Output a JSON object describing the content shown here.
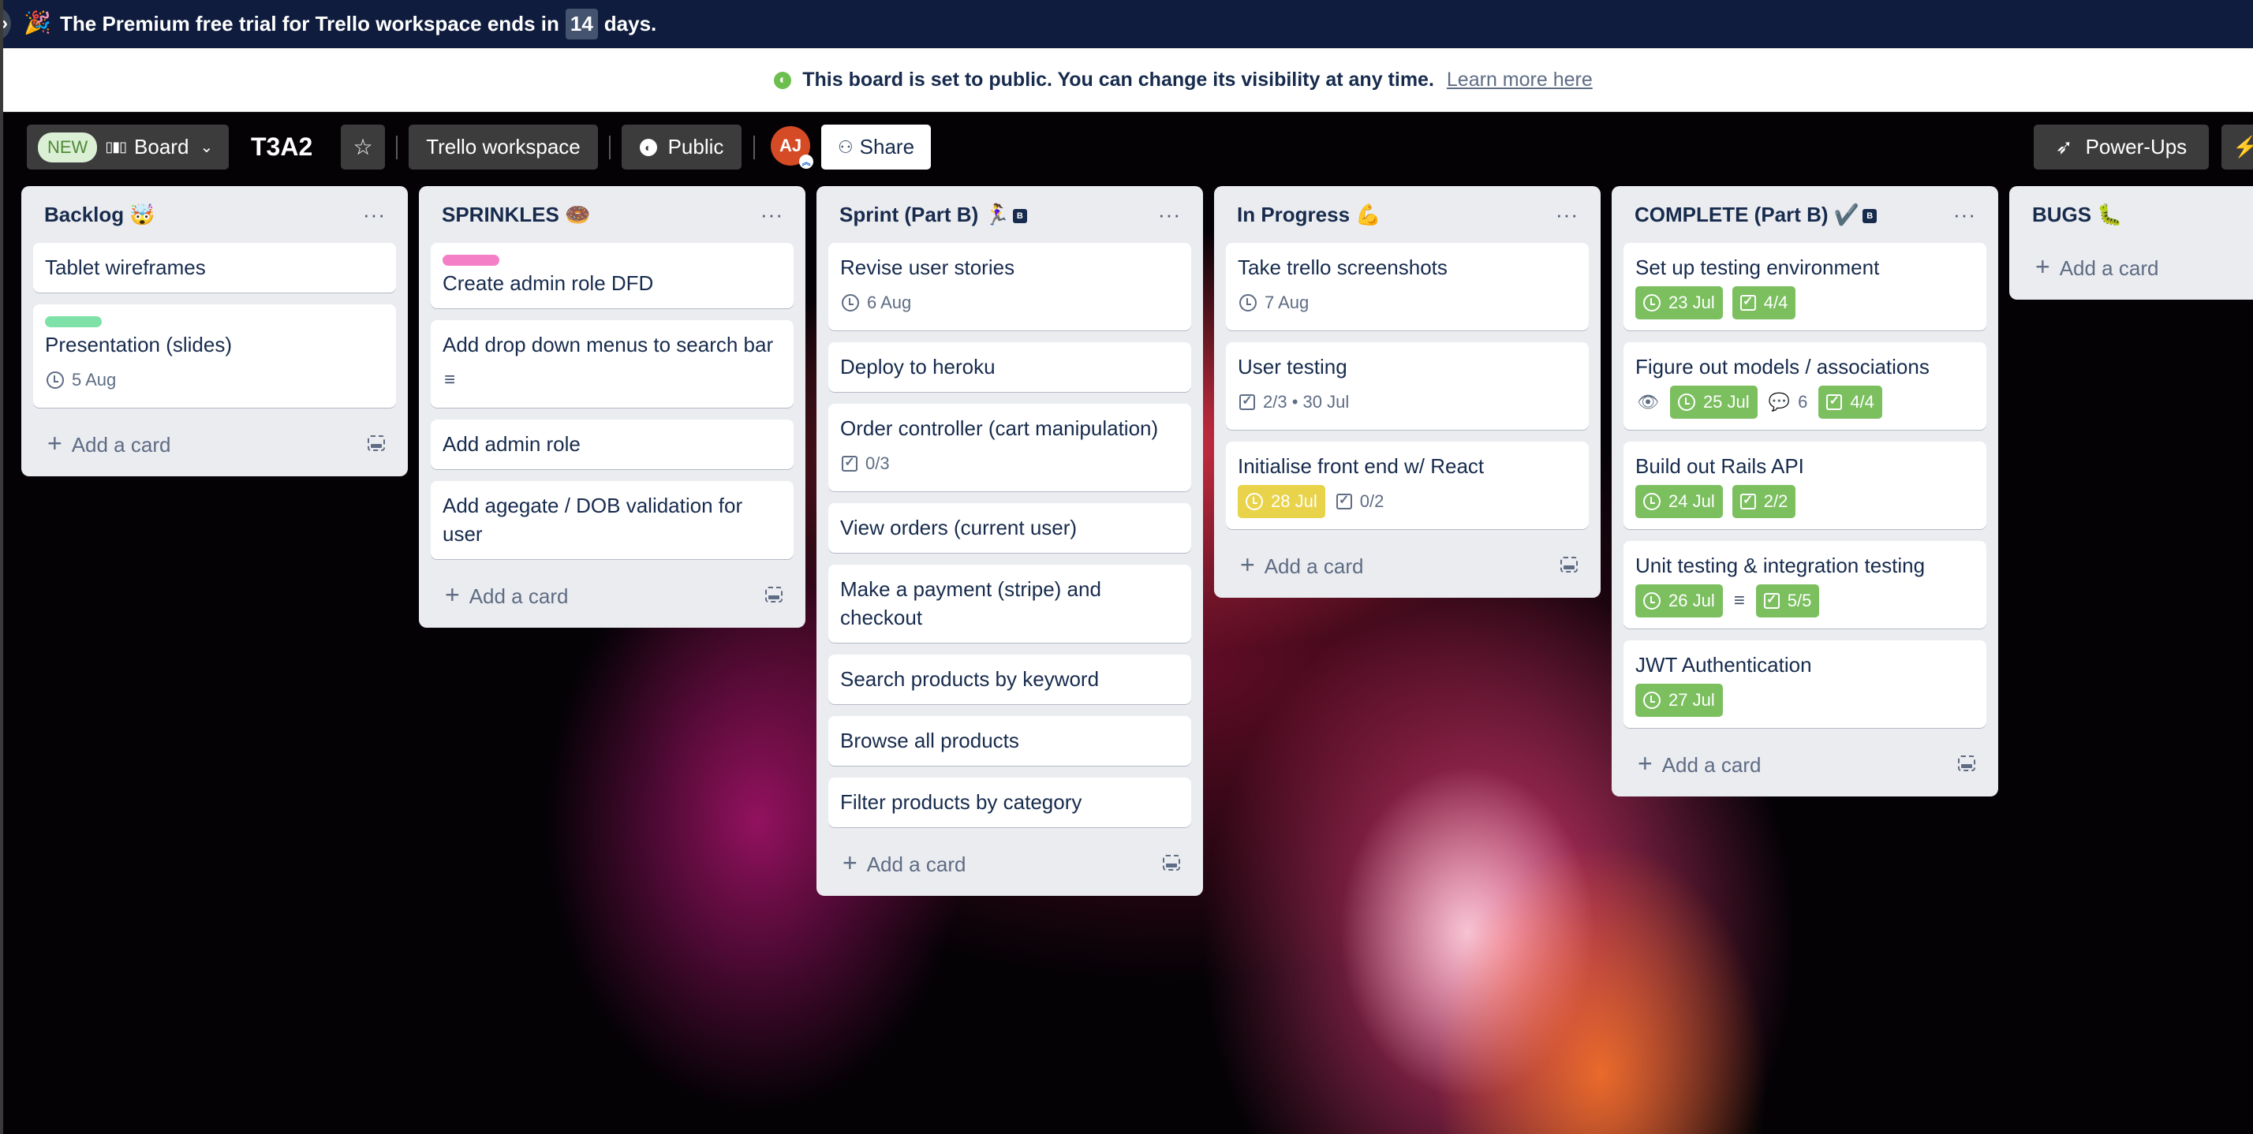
{
  "banner": {
    "icon": "party-popper-icon",
    "emoji": "🎉",
    "text_before": "The Premium free trial for Trello workspace ends in",
    "days": "14",
    "text_after": "days."
  },
  "notice": {
    "message": "This board is set to public. You can change its visibility at any time.",
    "link": "Learn more here"
  },
  "header": {
    "new_badge": "NEW",
    "view_label": "Board",
    "board_title": "T3A2",
    "workspace_label": "Trello workspace",
    "visibility_label": "Public",
    "avatar_initials": "AJ",
    "share_label": "Share",
    "powerups_label": "Power-Ups"
  },
  "add_card_label": "Add a card",
  "lists": [
    {
      "title": "Backlog 🤯",
      "cards": [
        {
          "title": "Tablet wireframes"
        },
        {
          "title": "Presentation (slides)",
          "label_color": "#7ee2a8",
          "due": "5 Aug"
        }
      ]
    },
    {
      "title": "SPRINKLES 🍩",
      "cards": [
        {
          "title": "Create admin role DFD",
          "label_color": "#f47fc7"
        },
        {
          "title": "Add drop down menus to search bar",
          "has_description": true
        },
        {
          "title": "Add admin role"
        },
        {
          "title": "Add agegate / DOB validation for user"
        }
      ]
    },
    {
      "title": "Sprint (Part B) 🏃‍♀️",
      "badge": "B",
      "cards": [
        {
          "title": "Revise user stories",
          "due": "6 Aug"
        },
        {
          "title": "Deploy to heroku"
        },
        {
          "title": "Order controller (cart manipulation)",
          "checklist": "0/3"
        },
        {
          "title": "View orders (current user)"
        },
        {
          "title": "Make a payment (stripe) and checkout"
        },
        {
          "title": "Search products by keyword"
        },
        {
          "title": "Browse all products"
        },
        {
          "title": "Filter products by category"
        }
      ]
    },
    {
      "title": "In Progress 💪",
      "cards": [
        {
          "title": "Take trello screenshots",
          "due": "7 Aug"
        },
        {
          "title": "User testing",
          "checklist_due": "2/3 • 30 Jul"
        },
        {
          "title": "Initialise front end w/ React",
          "due": "28 Jul",
          "due_status": "yellow",
          "checklist": "0/2"
        }
      ]
    },
    {
      "title": "COMPLETE (Part B) ✔️",
      "badge": "B",
      "cards": [
        {
          "title": "Set up testing environment",
          "due": "23 Jul",
          "due_status": "green",
          "checklist": "4/4",
          "checklist_status": "green"
        },
        {
          "title": "Figure out models / associations",
          "watching": true,
          "due": "25 Jul",
          "due_status": "green",
          "comments": "6",
          "checklist": "4/4",
          "checklist_status": "green"
        },
        {
          "title": "Build out Rails API",
          "due": "24 Jul",
          "due_status": "green",
          "checklist": "2/2",
          "checklist_status": "green"
        },
        {
          "title": "Unit testing & integration testing",
          "due": "26 Jul",
          "due_status": "green",
          "has_description": true,
          "checklist": "5/5",
          "checklist_status": "green"
        },
        {
          "title": "JWT Authentication",
          "due": "27 Jul",
          "due_status": "green"
        }
      ]
    },
    {
      "title": "BUGS 🐛",
      "cards": []
    }
  ]
}
